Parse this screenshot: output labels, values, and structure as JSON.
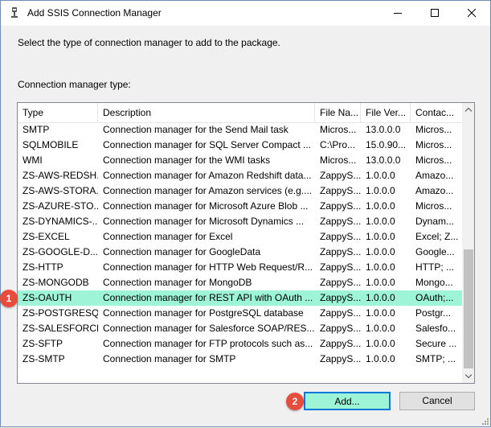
{
  "window": {
    "title": "Add SSIS Connection Manager"
  },
  "instruction": "Select the type of connection manager to add to the package.",
  "list_label": "Connection manager type:",
  "columns": [
    "Type",
    "Description",
    "File Na...",
    "File Ver...",
    "Contac..."
  ],
  "rows": [
    {
      "type": "SMTP",
      "description": "Connection manager for the Send Mail task",
      "file": "Micros...",
      "version": "13.0.0.0",
      "contact": "Micros..."
    },
    {
      "type": "SQLMOBILE",
      "description": "Connection manager for SQL Server Compact ...",
      "file": "C:\\Pro...",
      "version": "15.0.90...",
      "contact": "Micros..."
    },
    {
      "type": "WMI",
      "description": "Connection manager for the WMI tasks",
      "file": "Micros...",
      "version": "13.0.0.0",
      "contact": "Micros..."
    },
    {
      "type": "ZS-AWS-REDSH...",
      "description": "Connection manager for Amazon Redshift data...",
      "file": "ZappyS...",
      "version": "1.0.0.0",
      "contact": "Amazo..."
    },
    {
      "type": "ZS-AWS-STORA...",
      "description": "Connection manager for Amazon services (e.g....",
      "file": "ZappyS...",
      "version": "1.0.0.0",
      "contact": "Amazo..."
    },
    {
      "type": "ZS-AZURE-STO...",
      "description": "Connection manager for Microsoft Azure Blob ...",
      "file": "ZappyS...",
      "version": "1.0.0.0",
      "contact": "Micros..."
    },
    {
      "type": "ZS-DYNAMICS-...",
      "description": "Connection manager for Microsoft Dynamics ...",
      "file": "ZappyS...",
      "version": "1.0.0.0",
      "contact": "Dynam..."
    },
    {
      "type": "ZS-EXCEL",
      "description": "Connection manager for Excel",
      "file": "ZappyS...",
      "version": "1.0.0.0",
      "contact": "Excel; Z..."
    },
    {
      "type": "ZS-GOOGLE-D...",
      "description": "Connection manager for GoogleData",
      "file": "ZappyS...",
      "version": "1.0.0.0",
      "contact": "Google..."
    },
    {
      "type": "ZS-HTTP",
      "description": "Connection manager for HTTP Web Request/R...",
      "file": "ZappyS...",
      "version": "1.0.0.0",
      "contact": "HTTP; ..."
    },
    {
      "type": "ZS-MONGODB",
      "description": "Connection manager for MongoDB",
      "file": "ZappyS...",
      "version": "1.0.0.0",
      "contact": "Mongo..."
    },
    {
      "type": "ZS-OAUTH",
      "description": "Connection manager for REST API with OAuth ...",
      "file": "ZappyS...",
      "version": "1.0.0.0",
      "contact": "OAuth;...",
      "selected": true
    },
    {
      "type": "ZS-POSTGRESQL",
      "description": "Connection manager for PostgreSQL database",
      "file": "ZappyS...",
      "version": "1.0.0.0",
      "contact": "Postgr..."
    },
    {
      "type": "ZS-SALESFORCE",
      "description": "Connection manager for Salesforce SOAP/RES...",
      "file": "ZappyS...",
      "version": "1.0.0.0",
      "contact": "Salesfo..."
    },
    {
      "type": "ZS-SFTP",
      "description": "Connection manager for FTP protocols such as...",
      "file": "ZappyS...",
      "version": "1.0.0.0",
      "contact": "Secure ..."
    },
    {
      "type": "ZS-SMTP",
      "description": "Connection manager for SMTP",
      "file": "ZappyS...",
      "version": "1.0.0.0",
      "contact": "SMTP; ..."
    }
  ],
  "buttons": {
    "add": "Add...",
    "cancel": "Cancel"
  },
  "badges": {
    "one": "1",
    "two": "2"
  },
  "colors": {
    "selection": "#9ef4d6",
    "badge": "#e84c3d",
    "focus_border": "#0078d7"
  },
  "icons": {
    "title": "ssis-connection-icon",
    "minimize": "minimize-icon",
    "maximize": "maximize-icon",
    "close": "close-icon"
  }
}
